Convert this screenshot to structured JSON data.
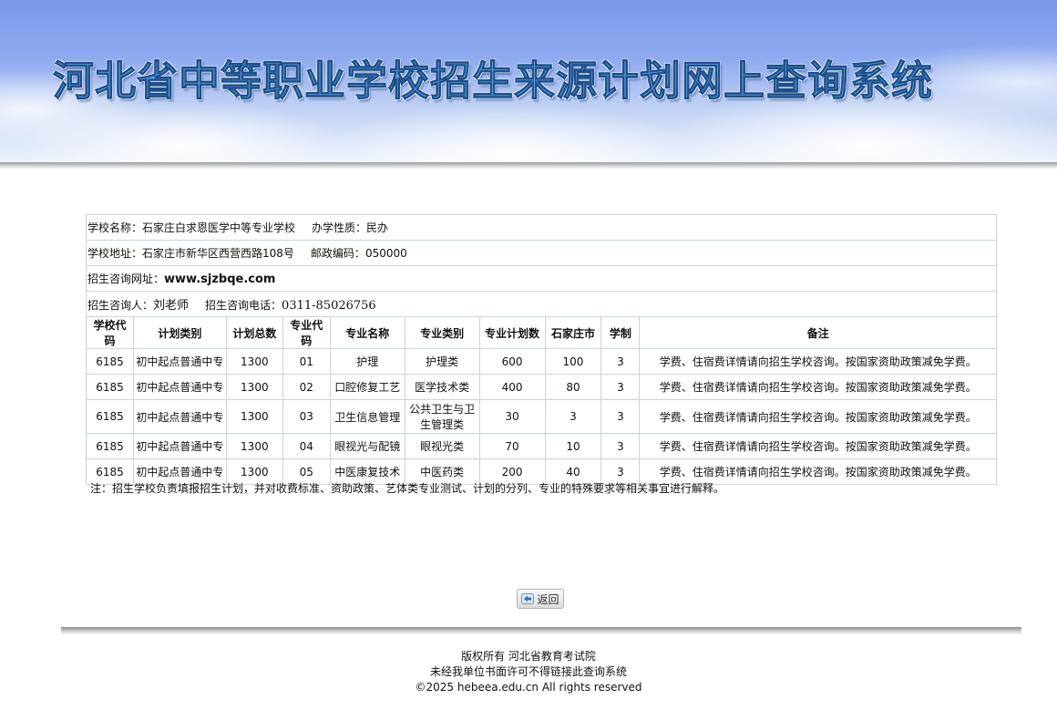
{
  "banner": {
    "title": "河北省中等职业学校招生来源计划网上查询系统"
  },
  "school": {
    "name_label": "学校名称：",
    "name": "石家庄白求恩医学中等专业学校",
    "nature_label": "办学性质：",
    "nature": "民办",
    "address_label": "学校地址：",
    "address": "石家庄市新华区西营西路108号",
    "postcode_label": "邮政编码：",
    "postcode": "050000",
    "website_label": "招生咨询网址：",
    "website": "www.sjzbqe.com",
    "contact_label": "招生咨询人：",
    "contact": "刘老师",
    "phone_label": "招生咨询电话：",
    "phone": "0311-85026756"
  },
  "table": {
    "headers": [
      "学校代码",
      "计划类别",
      "计划总数",
      "专业代码",
      "专业名称",
      "专业类别",
      "专业计划数",
      "石家庄市",
      "学制",
      "备注"
    ],
    "rows": [
      [
        "6185",
        "初中起点普通中专",
        "1300",
        "01",
        "护理",
        "护理类",
        "600",
        "100",
        "3",
        "学费、住宿费详情请向招生学校咨询。按国家资助政策减免学费。"
      ],
      [
        "6185",
        "初中起点普通中专",
        "1300",
        "02",
        "口腔修复工艺",
        "医学技术类",
        "400",
        "80",
        "3",
        "学费、住宿费详情请向招生学校咨询。按国家资助政策减免学费。"
      ],
      [
        "6185",
        "初中起点普通中专",
        "1300",
        "03",
        "卫生信息管理",
        "公共卫生与卫生管理类",
        "30",
        "3",
        "3",
        "学费、住宿费详情请向招生学校咨询。按国家资助政策减免学费。"
      ],
      [
        "6185",
        "初中起点普通中专",
        "1300",
        "04",
        "眼视光与配镜",
        "眼视光类",
        "70",
        "10",
        "3",
        "学费、住宿费详情请向招生学校咨询。按国家资助政策减免学费。"
      ],
      [
        "6185",
        "初中起点普通中专",
        "1300",
        "05",
        "中医康复技术",
        "中医药类",
        "200",
        "40",
        "3",
        "学费、住宿费详情请向招生学校咨询。按国家资助政策减免学费。"
      ]
    ]
  },
  "note": "注：招生学校负责填报招生计划，并对收费标准、资助政策、艺体类专业测试、计划的分列、专业的特殊要求等相关事宜进行解释。",
  "back_button": {
    "label": "返回",
    "icon": "back-arrow-icon"
  },
  "footer": {
    "copyright": "版权所有 河北省教育考试院",
    "warning": "未经我单位书面许可不得链接此查询系统",
    "rights": "©2025 hebeea.edu.cn All rights reserved"
  }
}
